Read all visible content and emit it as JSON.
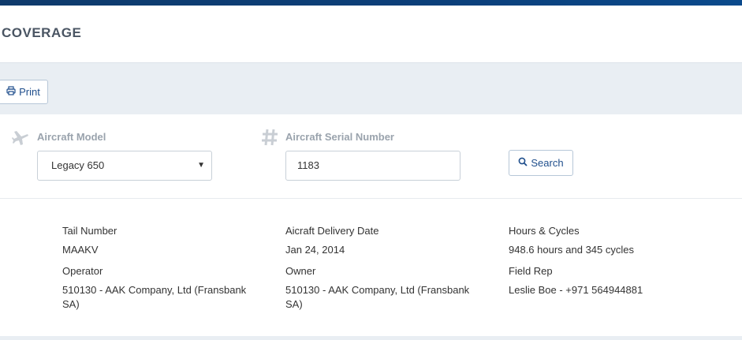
{
  "page": {
    "title": "COVERAGE"
  },
  "toolbar": {
    "print_label": "Print"
  },
  "search": {
    "model_label": "Aircraft Model",
    "model_value": "Legacy 650",
    "serial_label": "Aircraft Serial Number",
    "serial_value": "1183",
    "button_label": "Search"
  },
  "details": {
    "tail_number_label": "Tail Number",
    "tail_number_value": "MAAKV",
    "delivery_label": "Aicraft Delivery Date",
    "delivery_value": "Jan 24, 2014",
    "hours_label": "Hours & Cycles",
    "hours_value": "948.6 hours and 345 cycles",
    "operator_label": "Operator",
    "operator_value": "510130 - AAK Company, Ltd (Fransbank SA)",
    "owner_label": "Owner",
    "owner_value": "510130 - AAK Company, Ltd (Fransbank SA)",
    "field_rep_label": "Field Rep",
    "field_rep_value": "Leslie Boe - +971 564944881"
  },
  "icons": {
    "print": "print-icon",
    "plane": "plane-icon",
    "hash": "hash-icon",
    "search": "search-icon"
  },
  "colors": {
    "brand_bar": "#0f3a6b",
    "button_text": "#1f4e8c",
    "toolbar_bg": "#e9eef3",
    "label_gray": "#9aa3ad"
  }
}
